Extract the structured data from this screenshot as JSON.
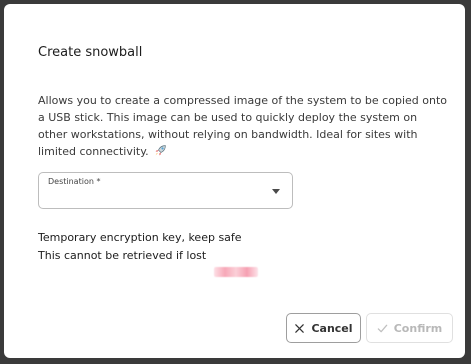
{
  "dialog": {
    "title": "Create snowball",
    "description": "Allows you to create a compressed image of the system to be copied onto a USB stick. This image can be used to quickly deploy the system on other workstations, without relying on bandwidth. Ideal for sites with limited connectivity.",
    "description_icon": "rocket-icon",
    "destination_field": {
      "label": "Destination *",
      "value": ""
    },
    "encryption_key_label": "Temporary encryption key, keep safe",
    "warning": "This cannot be retrieved if lost",
    "buttons": {
      "cancel": "Cancel",
      "confirm": "Confirm"
    }
  },
  "colors": {
    "backdrop": "#3a3a3a",
    "dialog_bg": "#ffffff",
    "disabled_text": "#b8b8b8",
    "redacted": "#f7a8b8"
  }
}
